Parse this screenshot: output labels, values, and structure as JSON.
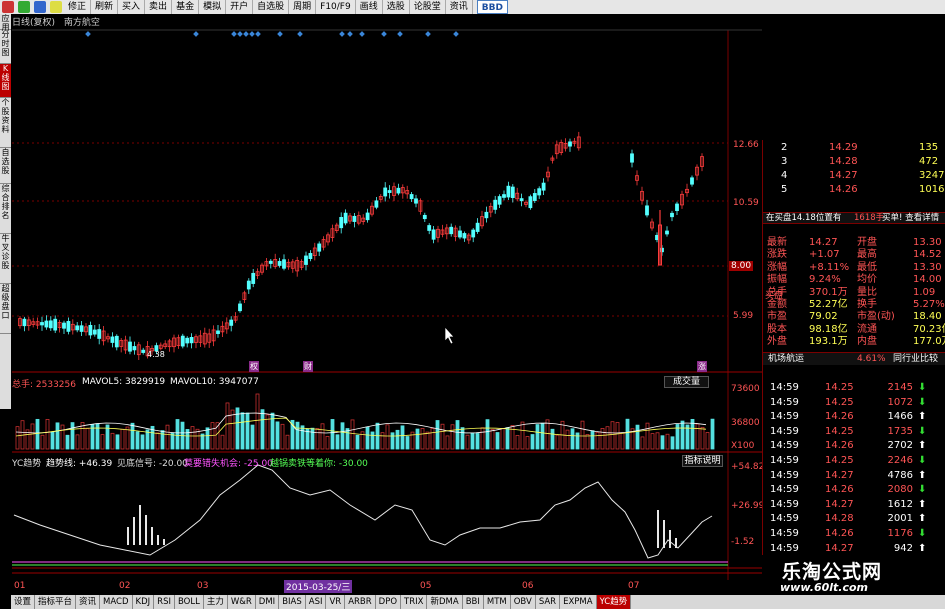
{
  "toolbar": {
    "buttons": [
      "修正",
      "刷新",
      "买入",
      "卖出",
      "基金",
      "模拟",
      "开户",
      "自选股",
      "周期",
      "F10/F9",
      "画线",
      "选股",
      "论股堂",
      "资讯"
    ],
    "bbd_label": "BBD"
  },
  "left_tabs": [
    "应用",
    "分时图",
    "K线图",
    "个股资料",
    "自选股",
    "综合排名",
    "牛叉诊股",
    "超级盘口"
  ],
  "header": {
    "period": "日线(复权)",
    "stock_name": "南方航空"
  },
  "price_axis": [
    "12.66",
    "10.59",
    "8.00",
    "5.99"
  ],
  "price_annotation": "4.38",
  "event_markers": [
    "权",
    "财",
    "涨"
  ],
  "volume_header": {
    "total": "总手: 2533256",
    "vol5": "MAVOL5: 3829919",
    "vol10": "MAVOL10: 3947077"
  },
  "volume_dropdown": "成交量",
  "volume_axis": [
    "73600",
    "36800",
    "X100"
  ],
  "indicator_header": {
    "name": "YC趋势",
    "trend": "趋势线: +46.39",
    "bottom": "见底信号: -20.00",
    "wait": "莫要错失机会: -25.00",
    "hold": "越锅卖铁等着你: -30.00"
  },
  "indicator_button": "指标说明",
  "indicator_axis": [
    "+54.82",
    "+26.99",
    "-1.52"
  ],
  "x_axis": {
    "months": [
      "01",
      "02",
      "03",
      "05",
      "06",
      "07"
    ],
    "date_highlight": "2015-03-25/三"
  },
  "order_book": [
    {
      "level": "2",
      "price": "14.29",
      "vol": "135"
    },
    {
      "level": "3",
      "price": "14.28",
      "vol": "472"
    },
    {
      "level": "4",
      "price": "14.27",
      "vol": "3247"
    },
    {
      "level": "5",
      "price": "14.26",
      "vol": "1016"
    }
  ],
  "order_book_side": "买盘",
  "inner_bar": {
    "left": "在买盘14.18位置有",
    "mid": "1618手",
    "right": "买单! 查看详情"
  },
  "quote": [
    {
      "l1": "最新",
      "v1": "14.27",
      "l2": "开盘",
      "v2": "13.30"
    },
    {
      "l1": "涨跌",
      "v1": "+1.07",
      "l2": "最高",
      "v2": "14.52"
    },
    {
      "l1": "涨幅",
      "v1": "+8.11%",
      "l2": "最低",
      "v2": "13.30"
    },
    {
      "l1": "振幅",
      "v1": "9.24%",
      "l2": "均价",
      "v2": "14.00"
    },
    {
      "l1": "总手",
      "v1": "370.1万",
      "l2": "量比",
      "v2": "1.09"
    },
    {
      "l1": "金额",
      "v1": "52.27亿",
      "l2": "换手",
      "v2": "5.27%"
    },
    {
      "l1": "市盈",
      "v1": "79.02",
      "l2": "市盈(动)",
      "v2": "18.40"
    },
    {
      "l1": "股本",
      "v1": "98.18亿",
      "l2": "流通",
      "v2": "70.23亿"
    },
    {
      "l1": "外盘",
      "v1": "193.1万",
      "l2": "内盘",
      "v2": "177.0万"
    }
  ],
  "industry": {
    "name": "机场航运",
    "change": "4.61%",
    "compare": "同行业比较"
  },
  "ticks": [
    {
      "time": "14:59",
      "price": "14.25",
      "vol": "2145",
      "dir": "down"
    },
    {
      "time": "14:59",
      "price": "14.25",
      "vol": "1072",
      "dir": "down"
    },
    {
      "time": "14:59",
      "price": "14.26",
      "vol": "1466",
      "dir": "up"
    },
    {
      "time": "14:59",
      "price": "14.25",
      "vol": "1735",
      "dir": "down"
    },
    {
      "time": "14:59",
      "price": "14.26",
      "vol": "2702",
      "dir": "up"
    },
    {
      "time": "14:59",
      "price": "14.25",
      "vol": "2246",
      "dir": "down"
    },
    {
      "time": "14:59",
      "price": "14.27",
      "vol": "4786",
      "dir": "up"
    },
    {
      "time": "14:59",
      "price": "14.26",
      "vol": "2080",
      "dir": "down"
    },
    {
      "time": "14:59",
      "price": "14.27",
      "vol": "1612",
      "dir": "up"
    },
    {
      "time": "14:59",
      "price": "14.28",
      "vol": "2001",
      "dir": "up"
    },
    {
      "time": "14:59",
      "price": "14.26",
      "vol": "1176",
      "dir": "down"
    },
    {
      "time": "14:59",
      "price": "14.27",
      "vol": "942",
      "dir": "up"
    }
  ],
  "bottom_tabs": [
    "设置",
    "指标平台",
    "资讯",
    "MACD",
    "KDJ",
    "RSI",
    "BOLL",
    "主力",
    "W&R",
    "DMI",
    "BIAS",
    "ASI",
    "VR",
    "ARBR",
    "DPO",
    "TRIX",
    "新DMA",
    "BBI",
    "MTM",
    "OBV",
    "SAR",
    "EXPMA",
    "YC趋势"
  ],
  "watermark": {
    "line1": "乐淘公式网",
    "line2": "www.60lt.com"
  },
  "colors": {
    "up": "#ff3c3c",
    "down": "#54ffff",
    "axis": "#7a0000",
    "bg": "#000000"
  }
}
